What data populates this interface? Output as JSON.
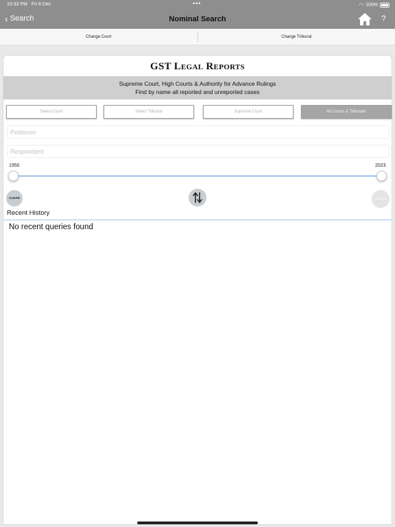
{
  "status_bar": {
    "time": "10:33 PM",
    "date": "Fri 8 Dec",
    "battery": "100%"
  },
  "nav": {
    "back_label": "Search",
    "title": "Nominal Search",
    "help_label": "?"
  },
  "tabs": [
    {
      "label": "Change Court"
    },
    {
      "label": "Change Tribunal"
    }
  ],
  "logo": "GST Legal Reports",
  "banner": {
    "line1": "Supreme Court, High Courts & Authority for Advance Rulings",
    "line2": "Find by name all reported and unreported cases"
  },
  "court_buttons": [
    {
      "label": "Select Court",
      "selected": false
    },
    {
      "label": "Select Tribunal",
      "selected": false
    },
    {
      "label": "Supreme Court",
      "selected": false
    },
    {
      "label": "All Courts & Tribunals",
      "selected": true
    }
  ],
  "fields": {
    "petitioner_placeholder": "Petitioner",
    "respondent_placeholder": "Respondent"
  },
  "year_range": {
    "min": "1950",
    "max": "2023",
    "low": 1950,
    "high": 2023
  },
  "actions": {
    "clear_label": "CLEAR",
    "search_label": "SEARCH"
  },
  "recent": {
    "title": "Recent History",
    "empty_message": "No recent queries found"
  },
  "colors": {
    "nav_bg": "#8e8e8e",
    "banner_bg": "#cfcfcf",
    "slider": "#4a90d9",
    "selected_btn": "#a6a6a6"
  }
}
